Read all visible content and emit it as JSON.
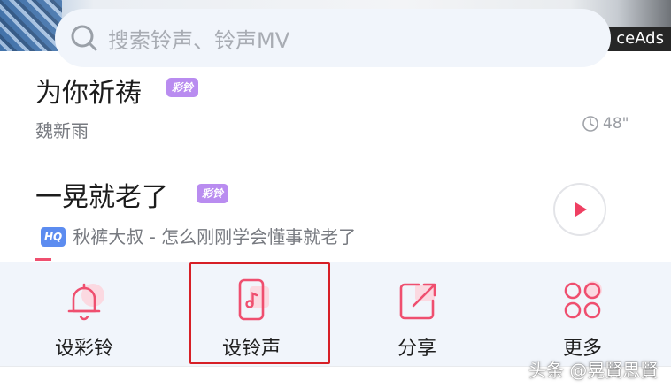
{
  "banner": {
    "ad_text": "ceAds"
  },
  "search": {
    "placeholder": "搜索铃声、铃声MV"
  },
  "songs": [
    {
      "title": "为你祈祷",
      "badge": "彩铃",
      "artist": "魏新雨",
      "duration": "48\""
    },
    {
      "title": "一晃就老了",
      "badge": "彩铃",
      "quality": "HQ",
      "artist_album": "秋裤大叔 - 怎么刚刚学会懂事就老了"
    }
  ],
  "actions": [
    {
      "label": "设彩铃",
      "icon": "bell-icon"
    },
    {
      "label": "设铃声",
      "icon": "phone-music-icon",
      "highlighted": true
    },
    {
      "label": "分享",
      "icon": "share-icon"
    },
    {
      "label": "更多",
      "icon": "more-circles-icon"
    }
  ],
  "watermark": "头条 @晃賢思賢",
  "colors": {
    "accent": "#ef4f6f",
    "badge": "#b98cf0",
    "hq": "#5c8cf0",
    "highlight_box": "#d71f26",
    "bar_bg": "#f1f5fb"
  }
}
